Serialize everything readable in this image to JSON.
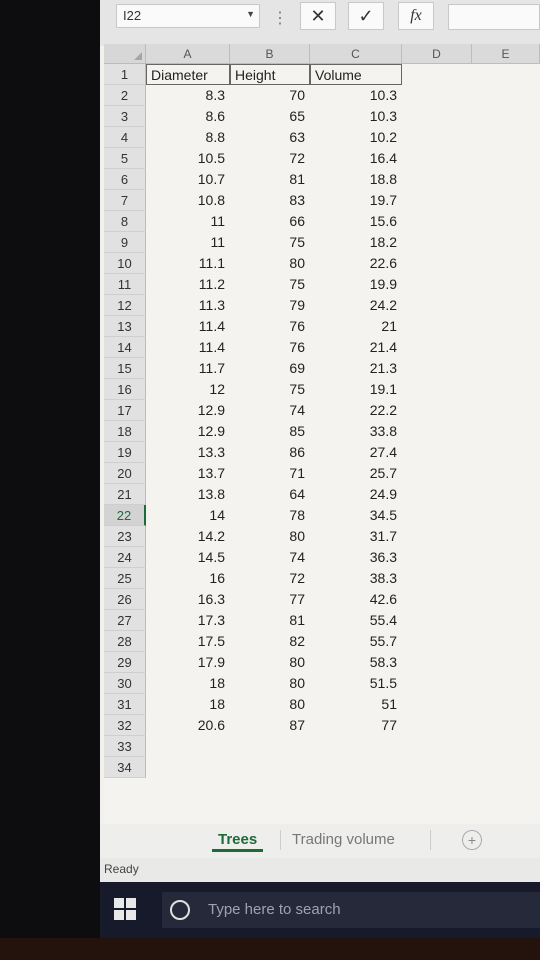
{
  "formula_bar": {
    "name_box": "I22",
    "cancel_icon": "✕",
    "enter_icon": "✓",
    "fx_label": "fx"
  },
  "columns": [
    "A",
    "B",
    "C",
    "D",
    "E"
  ],
  "headers": [
    "Diameter",
    "Height",
    "Volume"
  ],
  "rows": [
    {
      "n": "2",
      "d": "8.3",
      "h": "70",
      "v": "10.3"
    },
    {
      "n": "3",
      "d": "8.6",
      "h": "65",
      "v": "10.3"
    },
    {
      "n": "4",
      "d": "8.8",
      "h": "63",
      "v": "10.2"
    },
    {
      "n": "5",
      "d": "10.5",
      "h": "72",
      "v": "16.4"
    },
    {
      "n": "6",
      "d": "10.7",
      "h": "81",
      "v": "18.8"
    },
    {
      "n": "7",
      "d": "10.8",
      "h": "83",
      "v": "19.7"
    },
    {
      "n": "8",
      "d": "11",
      "h": "66",
      "v": "15.6"
    },
    {
      "n": "9",
      "d": "11",
      "h": "75",
      "v": "18.2"
    },
    {
      "n": "10",
      "d": "11.1",
      "h": "80",
      "v": "22.6"
    },
    {
      "n": "11",
      "d": "11.2",
      "h": "75",
      "v": "19.9"
    },
    {
      "n": "12",
      "d": "11.3",
      "h": "79",
      "v": "24.2"
    },
    {
      "n": "13",
      "d": "11.4",
      "h": "76",
      "v": "21"
    },
    {
      "n": "14",
      "d": "11.4",
      "h": "76",
      "v": "21.4"
    },
    {
      "n": "15",
      "d": "11.7",
      "h": "69",
      "v": "21.3"
    },
    {
      "n": "16",
      "d": "12",
      "h": "75",
      "v": "19.1"
    },
    {
      "n": "17",
      "d": "12.9",
      "h": "74",
      "v": "22.2"
    },
    {
      "n": "18",
      "d": "12.9",
      "h": "85",
      "v": "33.8"
    },
    {
      "n": "19",
      "d": "13.3",
      "h": "86",
      "v": "27.4"
    },
    {
      "n": "20",
      "d": "13.7",
      "h": "71",
      "v": "25.7"
    },
    {
      "n": "21",
      "d": "13.8",
      "h": "64",
      "v": "24.9"
    },
    {
      "n": "22",
      "d": "14",
      "h": "78",
      "v": "34.5"
    },
    {
      "n": "23",
      "d": "14.2",
      "h": "80",
      "v": "31.7"
    },
    {
      "n": "24",
      "d": "14.5",
      "h": "74",
      "v": "36.3"
    },
    {
      "n": "25",
      "d": "16",
      "h": "72",
      "v": "38.3"
    },
    {
      "n": "26",
      "d": "16.3",
      "h": "77",
      "v": "42.6"
    },
    {
      "n": "27",
      "d": "17.3",
      "h": "81",
      "v": "55.4"
    },
    {
      "n": "28",
      "d": "17.5",
      "h": "82",
      "v": "55.7"
    },
    {
      "n": "29",
      "d": "17.9",
      "h": "80",
      "v": "58.3"
    },
    {
      "n": "30",
      "d": "18",
      "h": "80",
      "v": "51.5"
    },
    {
      "n": "31",
      "d": "18",
      "h": "80",
      "v": "51"
    },
    {
      "n": "32",
      "d": "20.6",
      "h": "87",
      "v": "77"
    },
    {
      "n": "33",
      "d": "",
      "h": "",
      "v": ""
    },
    {
      "n": "34",
      "d": "",
      "h": "",
      "v": ""
    }
  ],
  "row1_label": "1",
  "active_row": "22",
  "sheet_tabs": [
    {
      "label": "Trees",
      "active": true
    },
    {
      "label": "Trading volume",
      "active": false
    }
  ],
  "status": "Ready",
  "taskbar": {
    "search_placeholder": "Type here to search"
  },
  "colors": {
    "accent": "#1e6b3a",
    "taskbar": "#161a2b"
  }
}
